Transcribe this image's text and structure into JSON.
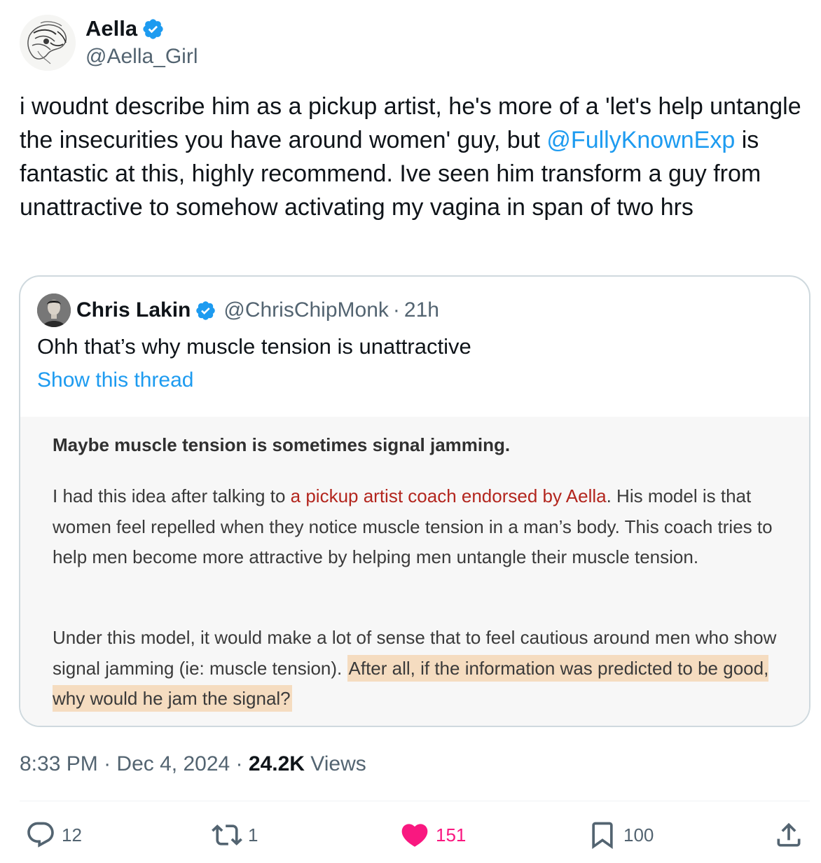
{
  "author": {
    "display_name": "Aella",
    "handle": "@Aella_Girl",
    "verified": true
  },
  "tweet": {
    "text_before_mention": "i woudnt describe him as a pickup artist, he's more of a 'let's help untangle the insecurities you have around women' guy, but ",
    "mention": "@FullyKnownExp",
    "text_after_mention": " is fantastic at this, highly recommend. Ive seen him transform a guy from unattractive to somehow activating my vagina in span of two hrs"
  },
  "quote": {
    "display_name": "Chris Lakin",
    "handle": "@ChrisChipMonk",
    "separator": "·",
    "time": "21h",
    "text": "Ohh that’s why muscle tension is unattractive",
    "show_thread": "Show this thread",
    "media": {
      "heading": "Maybe muscle tension is sometimes signal jamming.",
      "para1_before": "I had this idea after talking to ",
      "para1_link": "a pickup artist coach endorsed by Aella",
      "para1_after": ". His model is that women feel repelled when they notice muscle tension in a man’s body. This coach tries to help men become more attractive by helping men untangle their muscle tension.",
      "para2_plain": "Under this model, it would make a lot of sense that to feel cautious around men who show signal jamming (ie: muscle tension).",
      "para2_highlight": "After all, if the information was predicted to be good, why would he jam the signal?"
    }
  },
  "meta": {
    "time": "8:33 PM",
    "separator": "·",
    "date": "Dec 4, 2024",
    "views_count": "24.2K",
    "views_label": "Views"
  },
  "actions": {
    "replies": "12",
    "reposts": "1",
    "likes": "151",
    "bookmarks": "100"
  },
  "colors": {
    "accent": "#1d9bf0",
    "like": "#f91880",
    "secondary_text": "#536471",
    "highlight": "#f5dcc0",
    "link_red": "#b3261e"
  }
}
